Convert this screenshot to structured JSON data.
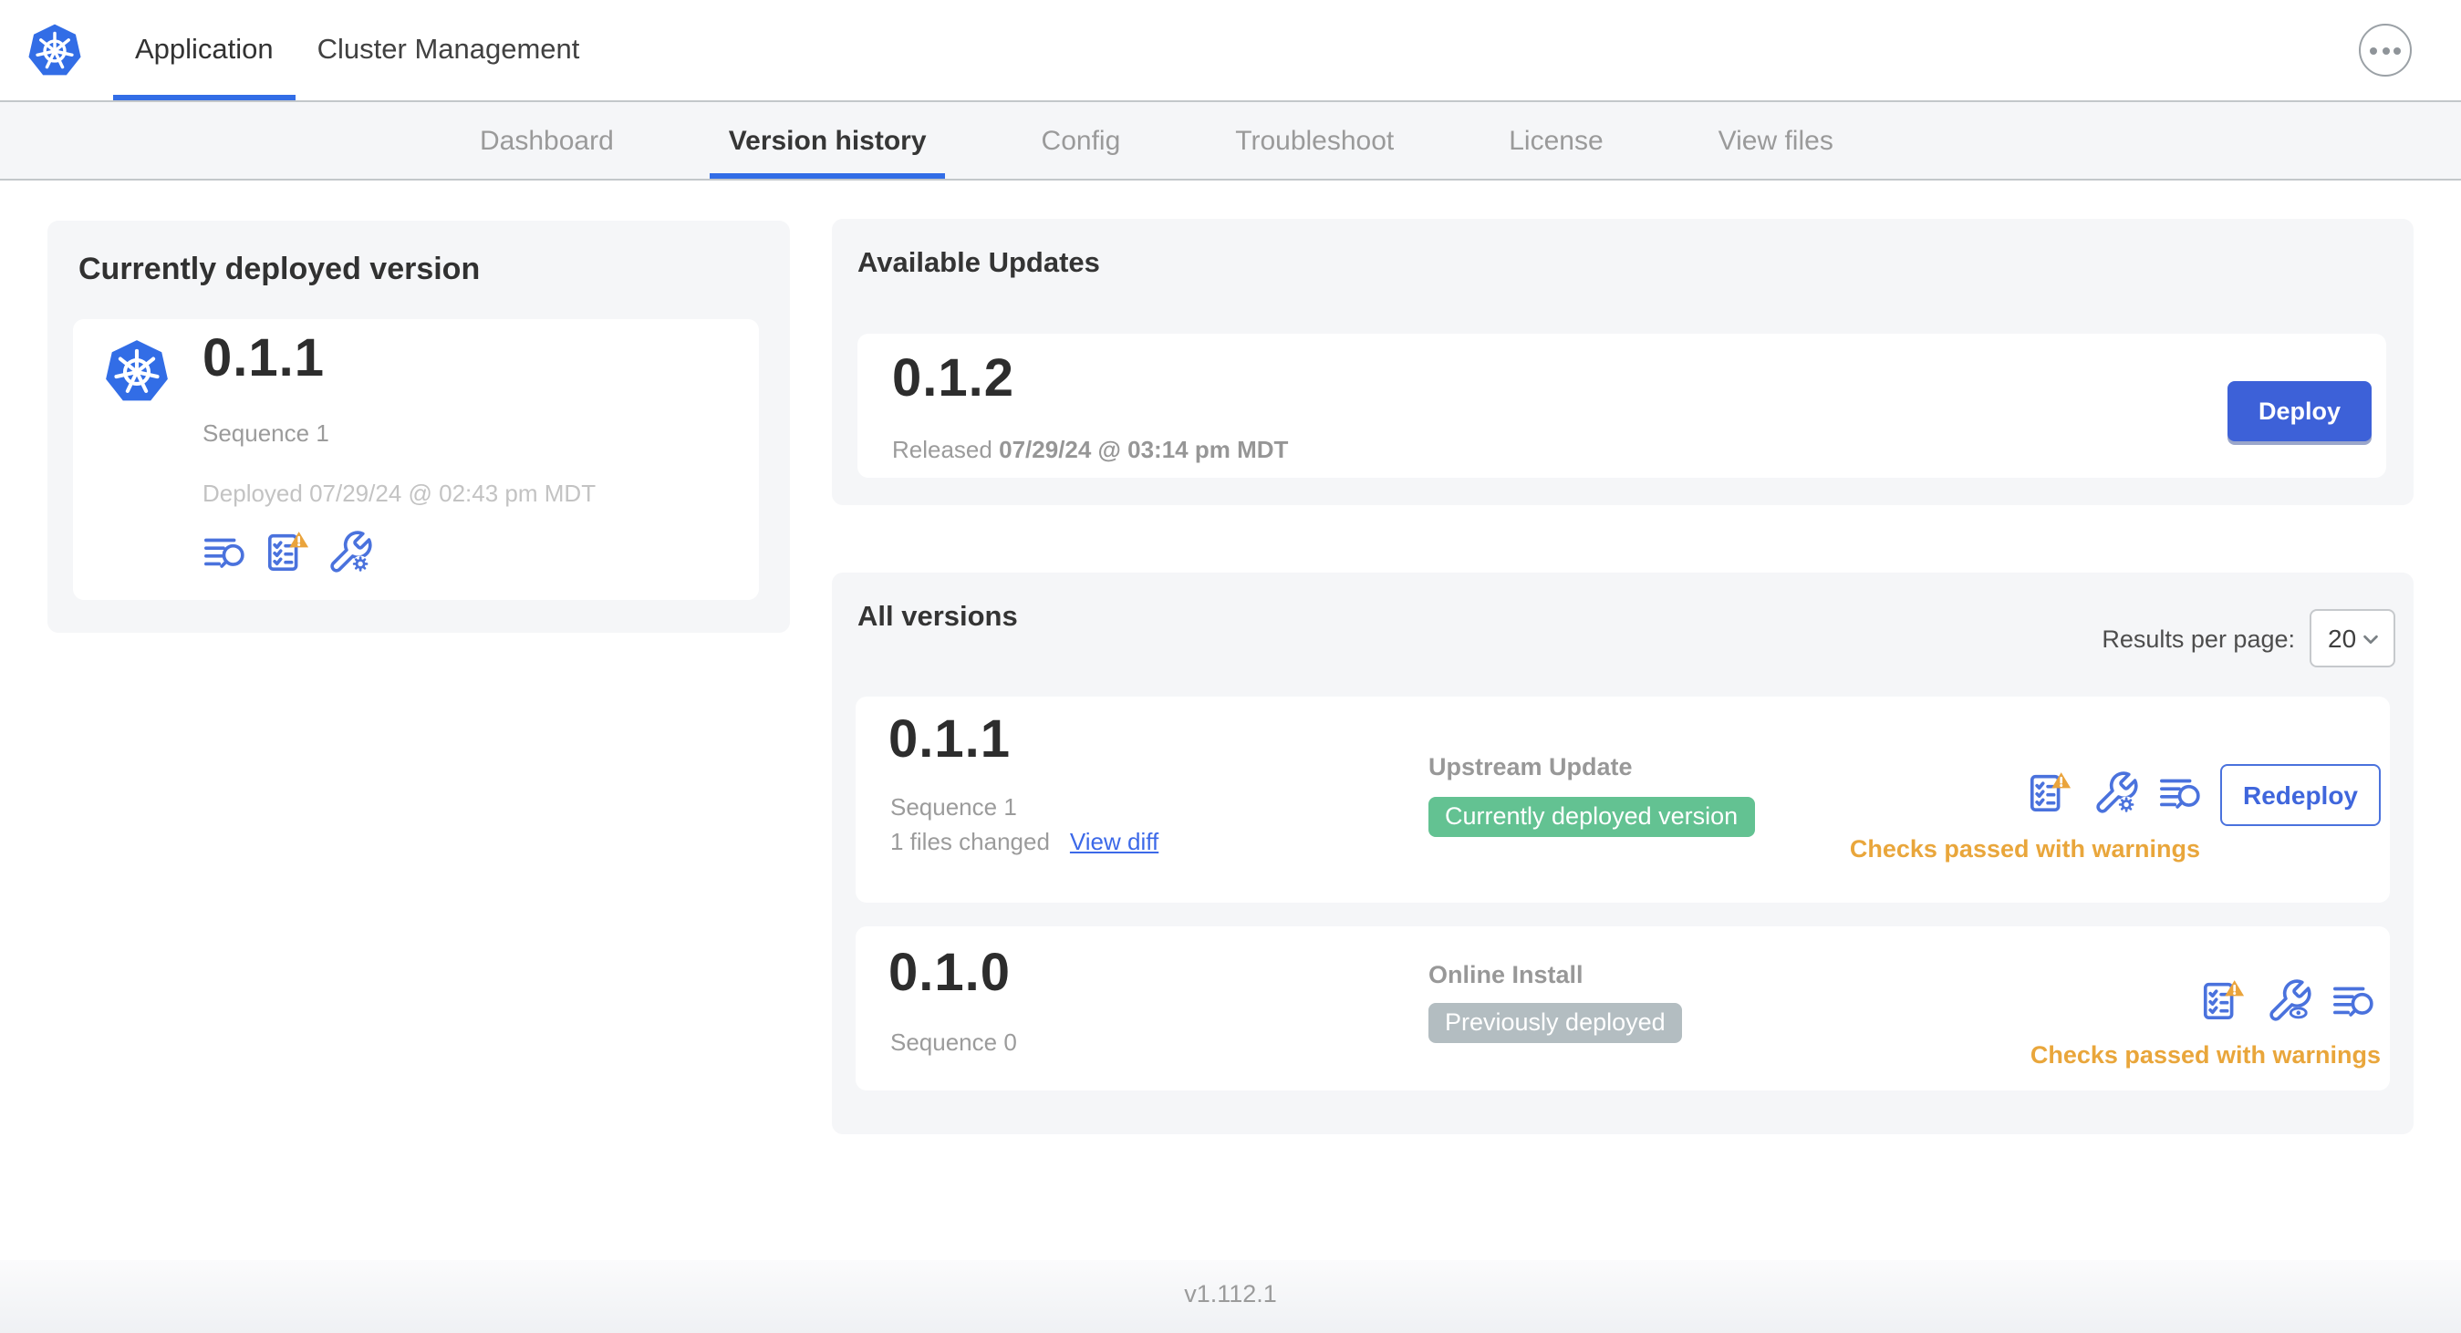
{
  "topbar": {
    "tabs": [
      {
        "label": "Application",
        "active": true
      },
      {
        "label": "Cluster Management",
        "active": false
      }
    ],
    "menu_icon": "ellipsis-icon"
  },
  "subnav": {
    "items": [
      {
        "label": "Dashboard",
        "active": false
      },
      {
        "label": "Version history",
        "active": true
      },
      {
        "label": "Config",
        "active": false
      },
      {
        "label": "Troubleshoot",
        "active": false
      },
      {
        "label": "License",
        "active": false
      },
      {
        "label": "View files",
        "active": false
      }
    ]
  },
  "current_version_card": {
    "title": "Currently deployed version",
    "version": "0.1.1",
    "sequence": "Sequence 1",
    "deployed_timestamp": "Deployed 07/29/24 @ 02:43 pm MDT",
    "icons": [
      "diff-summary-icon",
      "preflight-checks-warning-icon",
      "edit-config-icon"
    ]
  },
  "available_updates": {
    "title": "Available Updates",
    "version": "0.1.2",
    "released_label": "Released",
    "released_timestamp": "07/29/24 @ 03:14 pm MDT",
    "deploy_button": "Deploy"
  },
  "all_versions": {
    "title": "All versions",
    "results_per_page_label": "Results per page:",
    "results_per_page_value": "20",
    "rows": [
      {
        "version": "0.1.1",
        "sequence": "Sequence 1",
        "files_changed": "1 files changed",
        "diff_link": "View diff",
        "source": "Upstream Update",
        "status_badge": "Currently deployed version",
        "badge_color": "#63c292",
        "preflight_status": "Checks passed with warnings",
        "action_button": "Redeploy",
        "icons": [
          "preflight-checks-warning-icon",
          "edit-config-icon",
          "diff-summary-icon"
        ]
      },
      {
        "version": "0.1.0",
        "sequence": "Sequence 0",
        "source": "Online Install",
        "status_badge": "Previously deployed",
        "badge_color": "#b3bdc1",
        "preflight_status": "Checks passed with warnings",
        "icons": [
          "preflight-checks-warning-icon",
          "view-config-icon",
          "diff-summary-icon"
        ]
      }
    ]
  },
  "footer": {
    "version": "v1.112.1"
  },
  "colors": {
    "accent_blue": "#326de6",
    "button_blue": "#3d61d8",
    "icon_blue": "#4a72dd",
    "warning_orange": "#e9a63b",
    "success_green": "#63c292",
    "muted_badge_gray": "#b3bdc1",
    "card_gray": "#f5f6f8"
  }
}
